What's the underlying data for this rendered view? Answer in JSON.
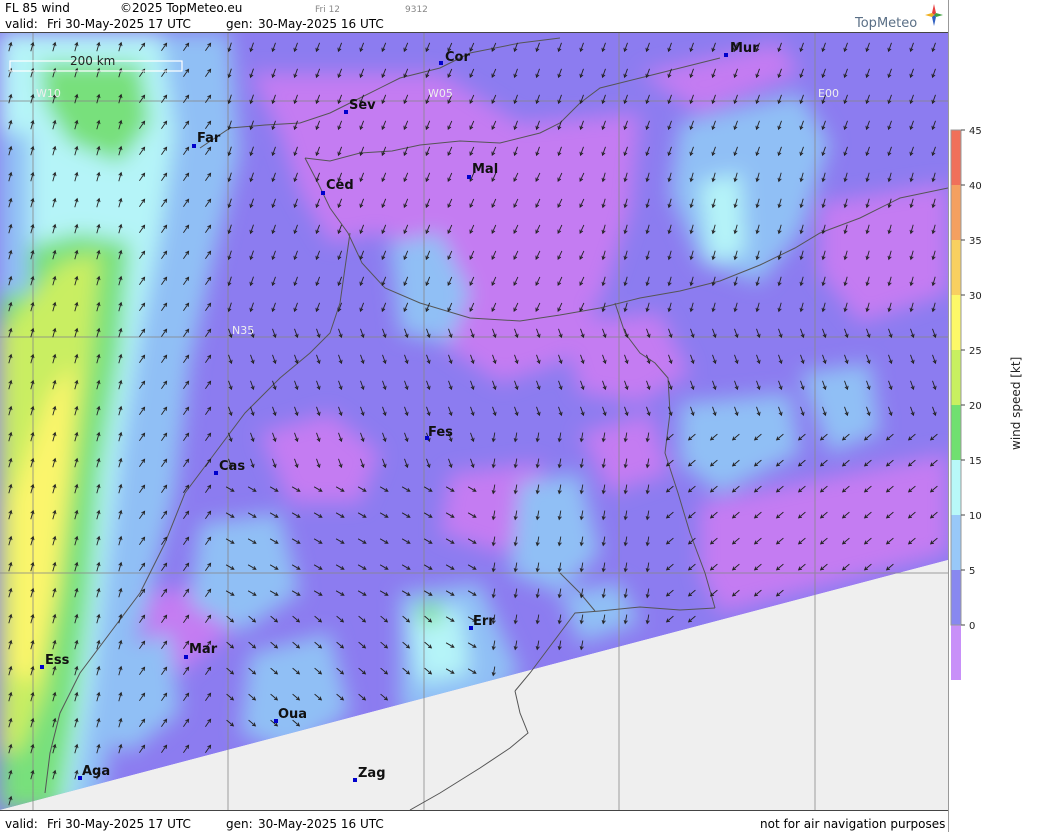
{
  "header": {
    "title": "FL 85 wind",
    "copyright": "©2025 TopMeteo.eu",
    "valid_label": "valid:",
    "valid_time": "Fri  30-May-2025  17 UTC",
    "gen_label": "gen:",
    "gen_time": "30-May-2025 16 UTC",
    "slot_label": "Fri 12",
    "run_code": "9312"
  },
  "logo": {
    "text": "TopMeteo"
  },
  "footer": {
    "valid_label": "valid:",
    "valid_time": "Fri  30-May-2025  17 UTC",
    "gen_label": "gen:",
    "gen_time": "30-May-2025 16 UTC",
    "disclaimer": "not for air navigation purposes"
  },
  "map": {
    "scale_bar_label": "200 km",
    "grid_labels": {
      "w10": "W10",
      "w05": "W05",
      "e00": "E00",
      "n35": "N35"
    },
    "cities": [
      {
        "code": "Cor"
      },
      {
        "code": "Mur"
      },
      {
        "code": "Sev"
      },
      {
        "code": "Far"
      },
      {
        "code": "Mal"
      },
      {
        "code": "Ced"
      },
      {
        "code": "Fes"
      },
      {
        "code": "Cas"
      },
      {
        "code": "Err"
      },
      {
        "code": "Ess"
      },
      {
        "code": "Mar"
      },
      {
        "code": "Oua"
      },
      {
        "code": "Aga"
      },
      {
        "code": "Zag"
      }
    ]
  },
  "legend": {
    "title": "wind speed [kt]",
    "ticks": [
      "45",
      "40",
      "35",
      "30",
      "25",
      "20",
      "15",
      "10",
      "5",
      "0"
    ],
    "colors": [
      "#f0705a",
      "#f4a060",
      "#f8d060",
      "#fcf868",
      "#c8f060",
      "#70e070",
      "#b8f8f8",
      "#98c8f8",
      "#8888f0",
      "#c890f8"
    ]
  },
  "colors": {
    "calm": "#c47cf2",
    "light": "#8c7cf0",
    "moderate": "#90bff5",
    "fresh": "#b5f4f8",
    "strong": "#78e07c",
    "very_strong": "#c9ee62",
    "gale": "#fbf56c",
    "no_data": "#efefef"
  }
}
